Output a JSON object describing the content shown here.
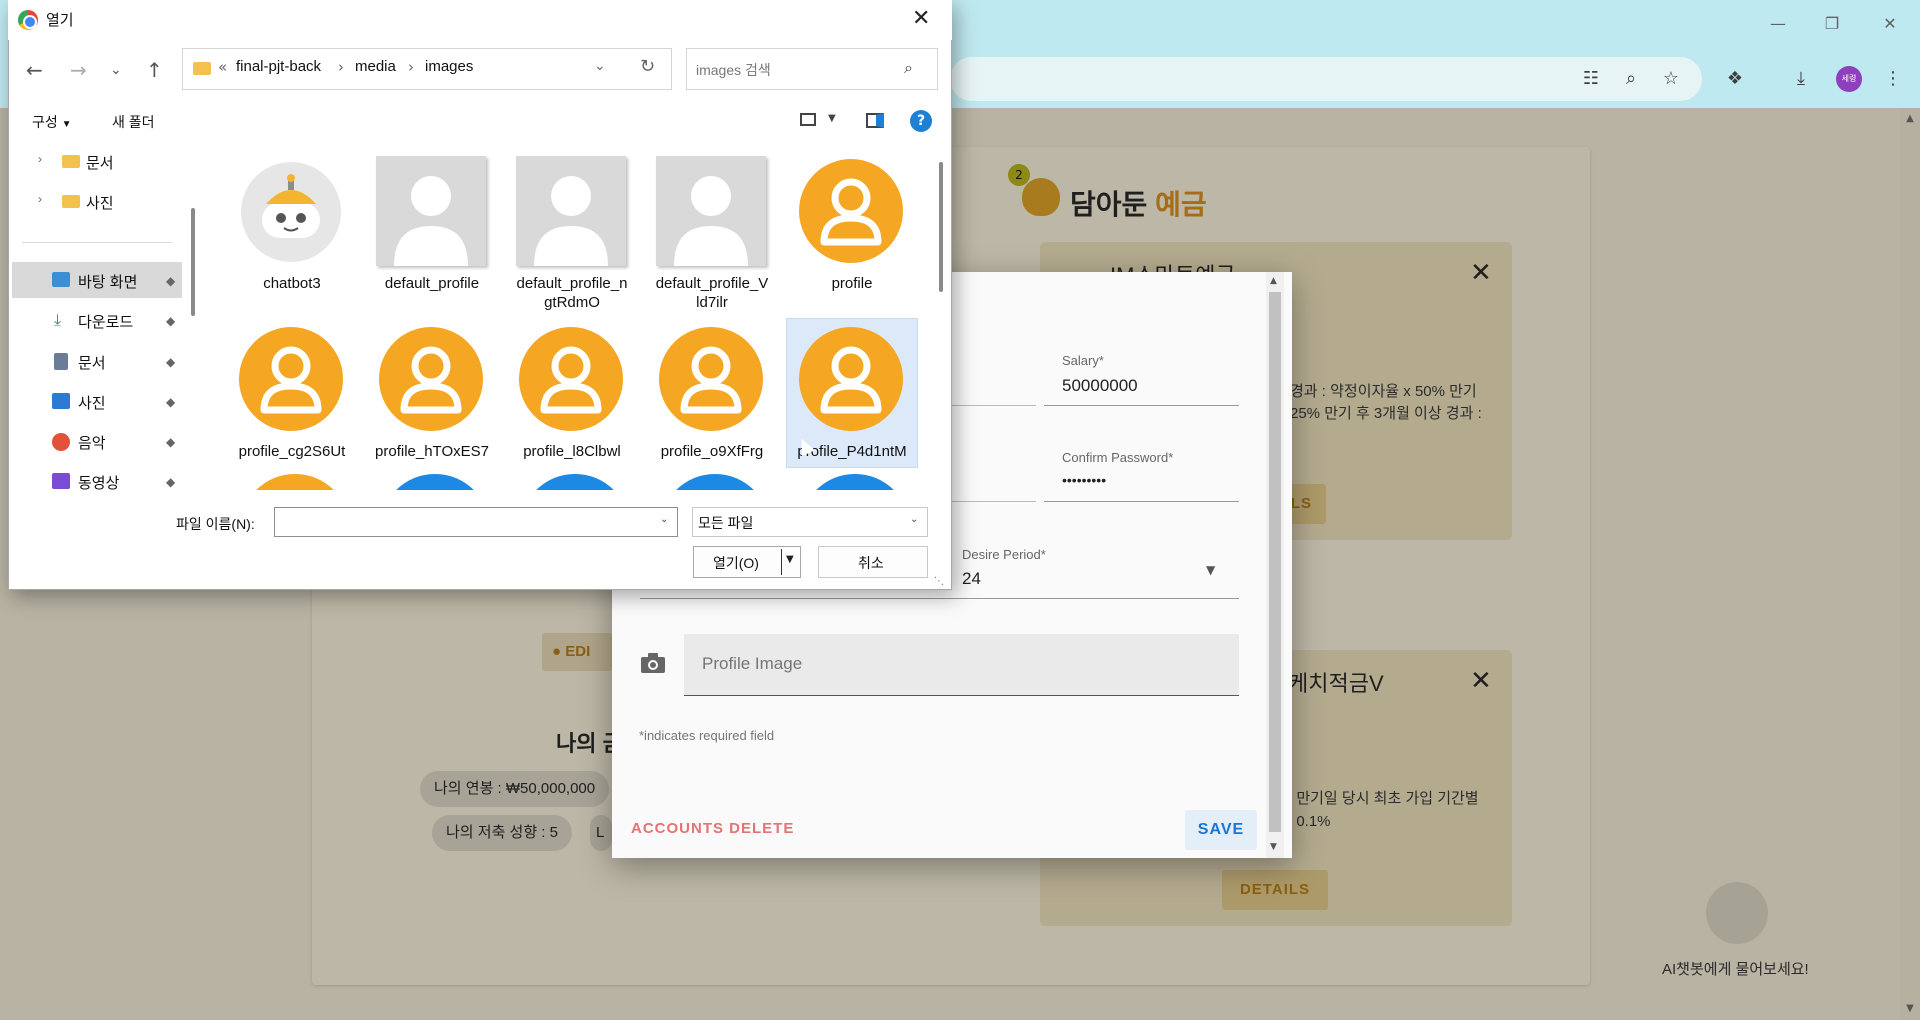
{
  "browser": {
    "profile_initials": "세령"
  },
  "page": {
    "saved_title_1": "담아둔 ",
    "saved_title_2": "예금",
    "badge_count": "2",
    "product_1": {
      "title": "IM스마트예금",
      "text_1": "경과 : 약정이자율 x 50% 만기",
      "text_2": "25% 만기 후 3개월 이상 경과 :",
      "details": "ILS"
    },
    "product_2": {
      "title": "케치적금V",
      "text_1": ": 만기일 당시 최초 가입 기간별",
      "text_2": ": 0.1%",
      "details": "DETAILS"
    },
    "edit_button": "EDI",
    "my_heading": "나의 금",
    "chip_salary": "나의 연봉 : ₩50,000,000",
    "chip_saving": "나의 저축 성향 : 5",
    "chip_partial": "L",
    "chatbot_caption": "AI챗봇에게 물어보세요!"
  },
  "modal": {
    "salary_label": "Salary*",
    "salary_value": "50000000",
    "confirm_password_label": "Confirm Password*",
    "confirm_password_value": "•••••••••",
    "desire_period_label": "Desire Period*",
    "desire_period_value": "24",
    "profile_image_placeholder": "Profile Image",
    "required_note": "*indicates required field",
    "delete_button": "ACCOUNTS DELETE",
    "save_button": "SAVE"
  },
  "dialog": {
    "title": "열기",
    "breadcrumb_prefix": "«",
    "breadcrumb": [
      "final-pjt-back",
      "media",
      "images"
    ],
    "search_placeholder": "images 검색",
    "organize": "구성",
    "new_folder": "새 폴더",
    "help": "?",
    "tree_top": [
      {
        "label": "문서"
      },
      {
        "label": "사진"
      }
    ],
    "tree_quick": [
      {
        "label": "바탕 화면",
        "color": "#3a8fd6"
      },
      {
        "label": "다운로드",
        "color": "#1a9c5b"
      },
      {
        "label": "문서",
        "color": "#6b7c99"
      },
      {
        "label": "사진",
        "color": "#2a7ad6"
      },
      {
        "label": "음악",
        "color": "#e0523a"
      },
      {
        "label": "동영상",
        "color": "#7a4bd6"
      }
    ],
    "files_row1": [
      {
        "name": "chatbot3",
        "kind": "bot"
      },
      {
        "name": "default_profile",
        "kind": "gray"
      },
      {
        "name": "default_profile_n gtRdmO",
        "kind": "gray"
      },
      {
        "name": "default_profile_V ld7ilr",
        "kind": "gray"
      },
      {
        "name": "profile",
        "kind": "orange"
      }
    ],
    "files_row2": [
      {
        "name": "profile_cg2S6Ut",
        "kind": "orange"
      },
      {
        "name": "profile_hTOxES7",
        "kind": "orange"
      },
      {
        "name": "profile_l8Clbwl",
        "kind": "orange"
      },
      {
        "name": "profile_o9XfFrg",
        "kind": "orange"
      },
      {
        "name": "profile_P4d1ntM",
        "kind": "orange"
      }
    ],
    "file_name_label": "파일 이름(N):",
    "file_name_value": "",
    "file_type": "모든 파일",
    "open_button": "열기(O)",
    "cancel_button": "취소"
  }
}
